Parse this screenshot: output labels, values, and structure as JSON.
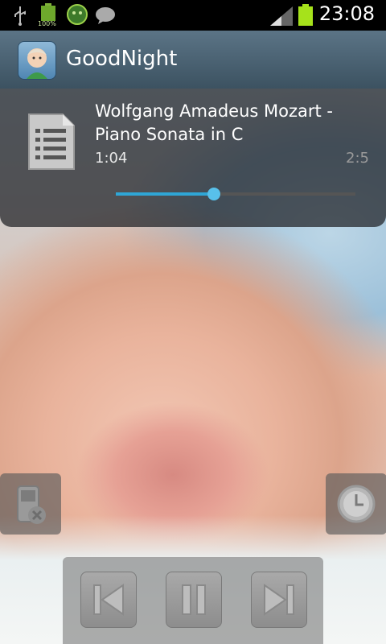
{
  "status_bar": {
    "time": "23:08",
    "battery_percent_label": "100%",
    "icons": [
      "usb-icon",
      "battery-full-icon",
      "android-icon",
      "chat-icon",
      "signal-icon",
      "battery-icon"
    ]
  },
  "action_bar": {
    "title": "GoodNight",
    "icon": "baby-face-icon"
  },
  "player": {
    "track_title": "Wolfgang Amadeus Mozart - Piano Sonata in C",
    "time_current": "1:04",
    "time_total": "2:5",
    "progress_fraction": 0.41,
    "accent_color": "#2fa6d6"
  },
  "controls": {
    "left_button_icon": "phone-mute-icon",
    "right_button_icon": "timer-clock-icon",
    "transport": [
      "previous-icon",
      "pause-icon",
      "next-icon"
    ]
  }
}
